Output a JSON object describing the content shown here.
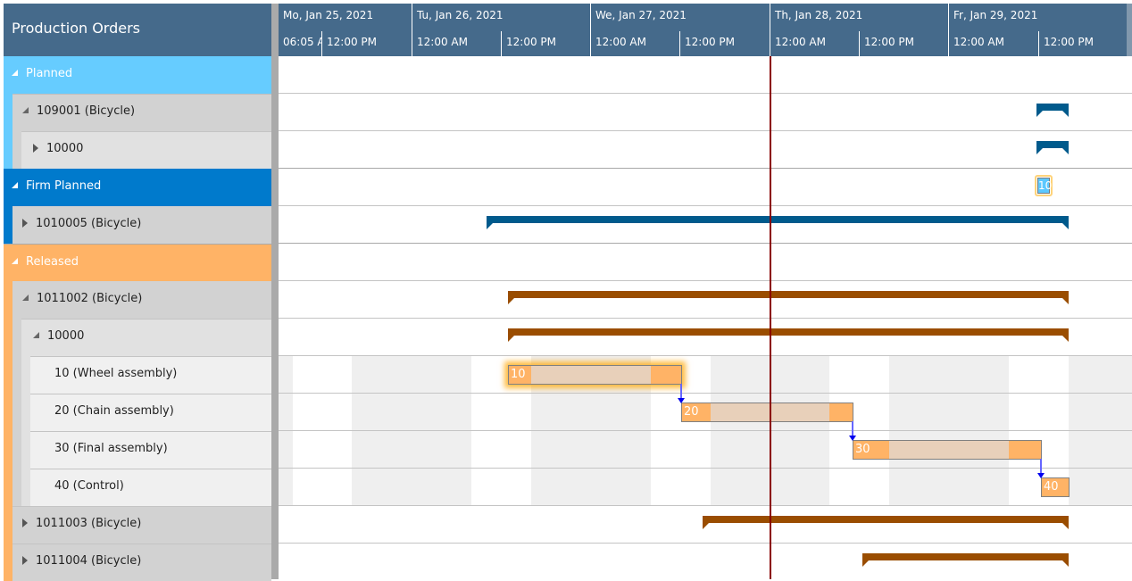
{
  "panel_title": "Production Orders",
  "timeline": {
    "days": [
      {
        "label": "Mo, Jan 25, 2021"
      },
      {
        "label": "Tu, Jan 26, 2021"
      },
      {
        "label": "We, Jan 27, 2021"
      },
      {
        "label": "Th, Jan 28, 2021"
      },
      {
        "label": "Fr, Jan 29, 2021"
      }
    ],
    "hours": [
      "06:05 A",
      "12:00 PM",
      "12:00 AM",
      "12:00 PM",
      "12:00 AM",
      "12:00 PM",
      "12:00 AM",
      "12:00 PM",
      "12:00 AM",
      "12:00 PM"
    ],
    "today_marker": "Th, Jan 28, 2021 12:00 AM"
  },
  "colors": {
    "planned": "#66ccff",
    "firm_planned": "#007acc",
    "released": "#ffb366",
    "planned_bar": "#005a8c",
    "released_bar": "#9a4d00",
    "today_line": "#8b0000"
  },
  "rows": [
    {
      "label": "Planned",
      "type": "group",
      "status": "planned",
      "expanded": true
    },
    {
      "label": "109001 (Bicycle)",
      "type": "order",
      "status": "planned",
      "expanded": true
    },
    {
      "label": "10000",
      "type": "routing",
      "status": "planned",
      "expanded": false
    },
    {
      "label": "Firm Planned",
      "type": "group",
      "status": "firm_planned",
      "expanded": true
    },
    {
      "label": "1010005 (Bicycle)",
      "type": "order",
      "status": "firm_planned",
      "expanded": false
    },
    {
      "label": "Released",
      "type": "group",
      "status": "released",
      "expanded": true
    },
    {
      "label": "1011002 (Bicycle)",
      "type": "order",
      "status": "released",
      "expanded": true
    },
    {
      "label": "10000",
      "type": "routing",
      "status": "released",
      "expanded": true
    },
    {
      "label": "10 (Wheel assembly)",
      "type": "operation",
      "status": "released"
    },
    {
      "label": "20 (Chain assembly)",
      "type": "operation",
      "status": "released"
    },
    {
      "label": "30 (Final assembly)",
      "type": "operation",
      "status": "released"
    },
    {
      "label": "40 (Control)",
      "type": "operation",
      "status": "released"
    },
    {
      "label": "1011003 (Bicycle)",
      "type": "order",
      "status": "released",
      "expanded": false
    },
    {
      "label": "1011004 (Bicycle)",
      "type": "order",
      "status": "released",
      "expanded": false
    }
  ],
  "bars": {
    "planned_milestone_label": "10",
    "tasks": [
      {
        "label": "10",
        "operation": "Wheel assembly"
      },
      {
        "label": "20",
        "operation": "Chain assembly"
      },
      {
        "label": "30",
        "operation": "Final assembly"
      },
      {
        "label": "40",
        "operation": "Control"
      }
    ]
  }
}
